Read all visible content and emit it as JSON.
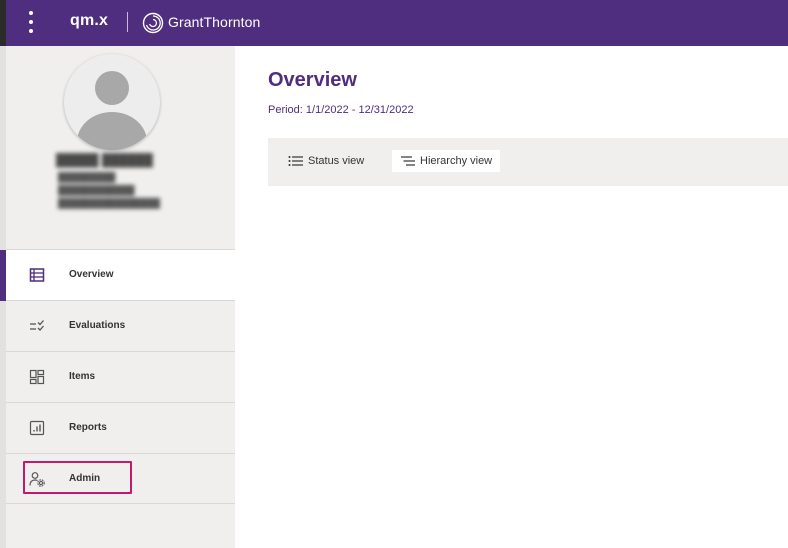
{
  "header": {
    "app_name": "qm.x",
    "brand_name": "GrantThornton",
    "icons": [
      "vertical-dots-icon",
      "grant-thornton-logo-icon"
    ]
  },
  "user": {
    "name": "",
    "details": []
  },
  "sidebar": {
    "items": [
      {
        "label": "Overview",
        "icon": "table-list-icon",
        "active": true
      },
      {
        "label": "Evaluations",
        "icon": "checklist-icon",
        "active": false
      },
      {
        "label": "Items",
        "icon": "dashboard-grid-icon",
        "active": false
      },
      {
        "label": "Reports",
        "icon": "report-chart-icon",
        "active": false
      },
      {
        "label": "Admin",
        "icon": "user-gear-icon",
        "active": false,
        "highlighted": true
      }
    ]
  },
  "main": {
    "title": "Overview",
    "period": "Period: 1/1/2022 - 12/31/2022",
    "views": [
      {
        "label": "Status view",
        "icon": "list-icon",
        "selected": false
      },
      {
        "label": "Hierarchy view",
        "icon": "hierarchy-list-icon",
        "selected": true
      }
    ]
  },
  "colors": {
    "brand_purple": "#4f2d7f",
    "sidebar_bg": "#f0efee",
    "highlight": "#c2196a"
  }
}
